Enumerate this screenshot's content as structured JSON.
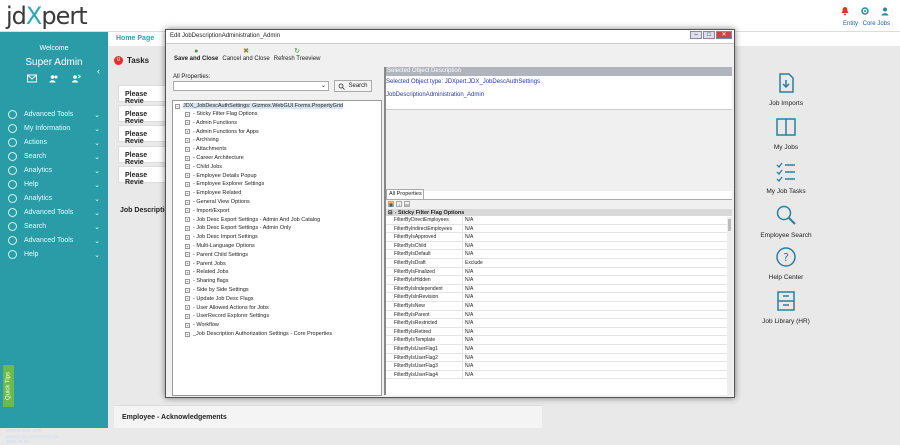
{
  "header": {
    "logo_left": "jd",
    "logo_x": "X",
    "logo_right": "pert",
    "entity": "Entity",
    "core_jobs": "Core Jobs"
  },
  "sidebar": {
    "welcome": "Welcome",
    "user": "Super Admin",
    "collapse": "‹",
    "items": [
      {
        "label": "Advanced Tools"
      },
      {
        "label": "My Information"
      },
      {
        "label": "Actions"
      },
      {
        "label": "Search"
      },
      {
        "label": "Analytics"
      },
      {
        "label": "Help"
      },
      {
        "label": "Analytics"
      },
      {
        "label": "Advanced Tools"
      },
      {
        "label": "Search"
      },
      {
        "label": "Advanced Tools"
      },
      {
        "label": "Help"
      }
    ],
    "quick_tips": "Quick Tips",
    "version": [
      "VM2020201 v20b",
      "uinat15.qa.jdxinternal.com",
      "2023.08.16"
    ]
  },
  "page": {
    "home_tab": "Home Page",
    "tasks_label": "Tasks",
    "tasks_count": "0",
    "review_label": "Please Revie",
    "job_desc": "Job Descriptio",
    "ack": "Employee - Acknowledgements",
    "right_items": [
      "Job Imports",
      "My Jobs",
      "My Job Tasks",
      "Employee Search",
      "Help Center",
      "Job Library (HR)"
    ]
  },
  "dialog": {
    "title": "Edit JobDescriptionAdministration_Admin",
    "toolbar": {
      "save_close": "Save and Close",
      "cancel_close": "Cancel and Close",
      "refresh": "Refresh Treeview"
    },
    "all_properties_label": "All Properties:",
    "search_btn": "Search",
    "tree_root": "JDX_JobDescAuthSettings: Gizmox.WebGUI.Forms.PropertyGrid",
    "tree_items": [
      "- Sticky Filter Flag Options",
      "- Admin Functions",
      "- Admin Functions for Apps",
      "- Archiving",
      "- Attachments",
      "- Career Architecture",
      "- Child Jobs",
      "- Employee Details Popup",
      "- Employee Explorer Settings",
      "- Employee Related",
      "- General View Options",
      "- Import/Export",
      "- Job Desc Export Settings - Admin And Job Catalog",
      "- Job Desc Export Settings - Admin Only",
      "- Job Desc Import Settings",
      "- Multi-Language Options",
      "- Parent Child Settings",
      "- Parent Jobs",
      "- Related Jobs",
      "- Sharing flags",
      "- Side by Side Settings",
      "- Update Job Desc Flags",
      "- User Allowed Actions for Jobs",
      "- UserRecord Explorer Settings",
      "- Workflow",
      "_Job Description Authorization Settings - Core Properties"
    ],
    "selected_desc_header": "Selected Object Description",
    "selected_type": "Selected Object type: JDXpert.JDX_JobDescAuthSettings",
    "selected_name": "JobDescriptionAdministration_Admin",
    "grid_tab": "All Properties",
    "category": "- Sticky Filter Flag Options",
    "properties": [
      {
        "n": "FilterByDirectEmployees",
        "v": "N/A"
      },
      {
        "n": "FilterByIndirectEmployees",
        "v": "N/A"
      },
      {
        "n": "FilterByIsApproved",
        "v": "N/A"
      },
      {
        "n": "FilterByIsChild",
        "v": "N/A"
      },
      {
        "n": "FilterByIsDefault",
        "v": "N/A"
      },
      {
        "n": "FilterByIsDraft",
        "v": "Exclude"
      },
      {
        "n": "FilterByIsFinalized",
        "v": "N/A"
      },
      {
        "n": "FilterByIsHidden",
        "v": "N/A"
      },
      {
        "n": "FilterByIsIndependent",
        "v": "N/A"
      },
      {
        "n": "FilterByIsInRevision",
        "v": "N/A"
      },
      {
        "n": "FilterByIsNew",
        "v": "N/A"
      },
      {
        "n": "FilterByIsParent",
        "v": "N/A"
      },
      {
        "n": "FilterByIsRestricted",
        "v": "N/A"
      },
      {
        "n": "FilterByIsRetired",
        "v": "N/A"
      },
      {
        "n": "FilterByIsTemplate",
        "v": "N/A"
      },
      {
        "n": "FilterByIsUserFlag1",
        "v": "N/A"
      },
      {
        "n": "FilterByIsUserFlag2",
        "v": "N/A"
      },
      {
        "n": "FilterByIsUserFlag3",
        "v": "N/A"
      },
      {
        "n": "FilterByIsUserFlag4",
        "v": "N/A"
      }
    ]
  }
}
